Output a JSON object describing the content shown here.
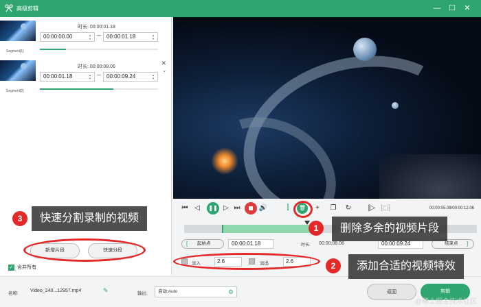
{
  "titlebar": {
    "title": "高级剪辑",
    "minimize": "—",
    "maximize": "☐",
    "close": "✕"
  },
  "segments": [
    {
      "name": "Segment[1]",
      "duration_label": "时长: 00:00:01.18",
      "start": "00:00:00.00",
      "end": "00:00:01.18",
      "progress": 0.22
    },
    {
      "name": "Segment[2]",
      "duration_label": "时长: 00:00:08.06",
      "start": "00:00:01.18",
      "end": "00:00:09.24",
      "progress": 0.62
    }
  ],
  "left_buttons": {
    "new_segment": "新增片段",
    "quick_split": "快速分段"
  },
  "merge": {
    "label": "合并所有",
    "checked": true
  },
  "controls": {
    "timecode": "00:00:05.08/00:00:12.06"
  },
  "range": {
    "start_label": "起始点",
    "start_value": "00:00:01.18",
    "duration_label": "时长:",
    "duration_value": "00:00:08.06",
    "end_value": "00:00:09.24",
    "end_label": "结束点"
  },
  "timeline": {
    "selection_fraction": [
      0.13,
      0.43
    ],
    "playhead_fraction": 0.41
  },
  "fade": {
    "in_label": "淡入",
    "in_value": "2.6",
    "out_label": "淡出",
    "out_value": "2.6"
  },
  "bottom": {
    "name_label": "名称:",
    "file_name": "Video_240...12957.mp4",
    "output_label": "输出:",
    "output_value": "自动;Auto",
    "back_button": "返回",
    "save_button": "剪辑"
  },
  "annotations": {
    "a1": {
      "number": "1",
      "text": "删除多余的视频片段"
    },
    "a2": {
      "number": "2",
      "text": "添加合适的视频特效"
    },
    "a3": {
      "number": "3",
      "text": "快速分割录制的视频"
    }
  },
  "watermark": "@稀土掘金技术社区",
  "colors": {
    "accent": "#2fa66f",
    "annotation": "#e52929"
  }
}
